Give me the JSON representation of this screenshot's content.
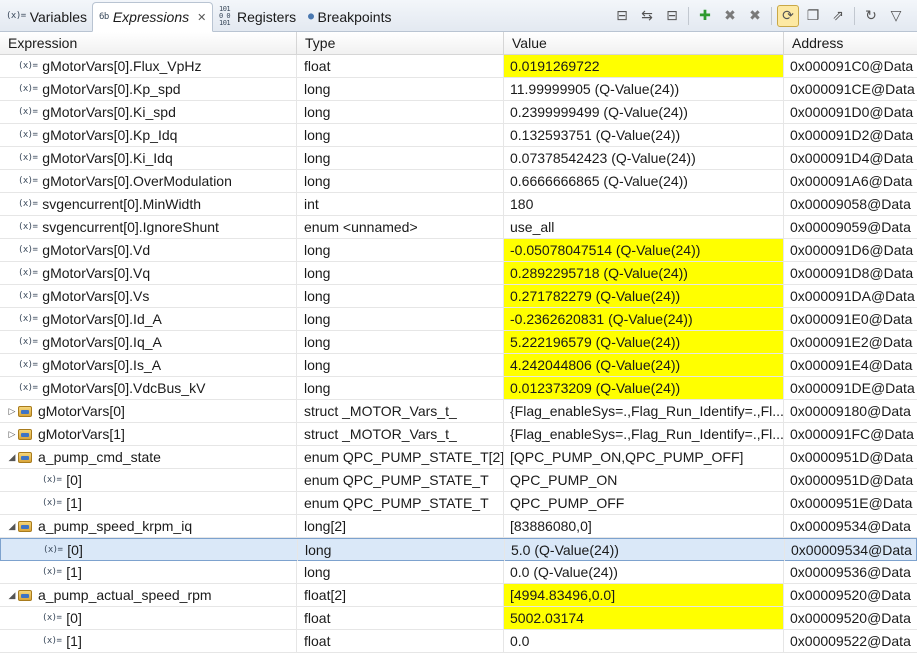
{
  "tabs": [
    {
      "label": "Variables",
      "icon": "(x)="
    },
    {
      "label": "Expressions",
      "icon": "6b",
      "close": "✕"
    },
    {
      "label": "Registers",
      "icon": "1010 0101"
    },
    {
      "label": "Breakpoints",
      "icon": "●"
    }
  ],
  "toolbar": [
    {
      "name": "collapse-all-icon",
      "glyph": "⊟"
    },
    {
      "name": "show-type-icon",
      "glyph": "⇆"
    },
    {
      "name": "minimize-icon",
      "glyph": "⊟"
    },
    {
      "name": "add-expression-icon",
      "glyph": "✚"
    },
    {
      "name": "remove-icon",
      "glyph": "✖"
    },
    {
      "name": "remove-all-icon",
      "glyph": "✖"
    },
    {
      "name": "continuous-refresh-icon",
      "glyph": "⟳"
    },
    {
      "name": "new-view-icon",
      "glyph": "❐"
    },
    {
      "name": "export-icon",
      "glyph": "⇗"
    },
    {
      "name": "refresh-icon",
      "glyph": "↻"
    },
    {
      "name": "view-menu-icon",
      "glyph": "▽"
    }
  ],
  "columns": {
    "expression": "Expression",
    "type": "Type",
    "value": "Value",
    "address": "Address"
  },
  "highlight_color": "#ffff00",
  "rows": [
    {
      "level": 0,
      "twisty": "",
      "icon": "var",
      "expr": "gMotorVars[0].Flux_VpHz",
      "type": "float",
      "value": "0.0191269722",
      "address": "0x000091C0@Data",
      "hl": true
    },
    {
      "level": 0,
      "twisty": "",
      "icon": "var",
      "expr": "gMotorVars[0].Kp_spd",
      "type": "long",
      "value": "11.99999905 (Q-Value(24))",
      "address": "0x000091CE@Data",
      "hl": false
    },
    {
      "level": 0,
      "twisty": "",
      "icon": "var",
      "expr": "gMotorVars[0].Ki_spd",
      "type": "long",
      "value": "0.2399999499 (Q-Value(24))",
      "address": "0x000091D0@Data",
      "hl": false
    },
    {
      "level": 0,
      "twisty": "",
      "icon": "var",
      "expr": "gMotorVars[0].Kp_Idq",
      "type": "long",
      "value": "0.132593751 (Q-Value(24))",
      "address": "0x000091D2@Data",
      "hl": false
    },
    {
      "level": 0,
      "twisty": "",
      "icon": "var",
      "expr": "gMotorVars[0].Ki_Idq",
      "type": "long",
      "value": "0.07378542423 (Q-Value(24))",
      "address": "0x000091D4@Data",
      "hl": false
    },
    {
      "level": 0,
      "twisty": "",
      "icon": "var",
      "expr": "gMotorVars[0].OverModulation",
      "type": "long",
      "value": "0.6666666865 (Q-Value(24))",
      "address": "0x000091A6@Data",
      "hl": false
    },
    {
      "level": 0,
      "twisty": "",
      "icon": "var",
      "expr": "svgencurrent[0].MinWidth",
      "type": "int",
      "value": "180",
      "address": "0x00009058@Data",
      "hl": false
    },
    {
      "level": 0,
      "twisty": "",
      "icon": "var",
      "expr": "svgencurrent[0].IgnoreShunt",
      "type": "enum <unnamed>",
      "value": "use_all",
      "address": "0x00009059@Data",
      "hl": false
    },
    {
      "level": 0,
      "twisty": "",
      "icon": "var",
      "expr": "gMotorVars[0].Vd",
      "type": "long",
      "value": "-0.05078047514 (Q-Value(24))",
      "address": "0x000091D6@Data",
      "hl": true
    },
    {
      "level": 0,
      "twisty": "",
      "icon": "var",
      "expr": "gMotorVars[0].Vq",
      "type": "long",
      "value": "0.2892295718 (Q-Value(24))",
      "address": "0x000091D8@Data",
      "hl": true
    },
    {
      "level": 0,
      "twisty": "",
      "icon": "var",
      "expr": "gMotorVars[0].Vs",
      "type": "long",
      "value": "0.271782279 (Q-Value(24))",
      "address": "0x000091DA@Data",
      "hl": true
    },
    {
      "level": 0,
      "twisty": "",
      "icon": "var",
      "expr": "gMotorVars[0].Id_A",
      "type": "long",
      "value": "-0.2362620831 (Q-Value(24))",
      "address": "0x000091E0@Data",
      "hl": true
    },
    {
      "level": 0,
      "twisty": "",
      "icon": "var",
      "expr": "gMotorVars[0].Iq_A",
      "type": "long",
      "value": "5.222196579 (Q-Value(24))",
      "address": "0x000091E2@Data",
      "hl": true
    },
    {
      "level": 0,
      "twisty": "",
      "icon": "var",
      "expr": "gMotorVars[0].Is_A",
      "type": "long",
      "value": "4.242044806 (Q-Value(24))",
      "address": "0x000091E4@Data",
      "hl": true
    },
    {
      "level": 0,
      "twisty": "",
      "icon": "var",
      "expr": "gMotorVars[0].VdcBus_kV",
      "type": "long",
      "value": "0.012373209 (Q-Value(24))",
      "address": "0x000091DE@Data",
      "hl": true
    },
    {
      "level": 0,
      "twisty": "▷",
      "icon": "struct",
      "expr": "gMotorVars[0]",
      "type": "struct _MOTOR_Vars_t_",
      "value": "{Flag_enableSys=.,Flag_Run_Identify=.,Fl...",
      "address": "0x00009180@Data",
      "hl": false
    },
    {
      "level": 0,
      "twisty": "▷",
      "icon": "struct",
      "expr": "gMotorVars[1]",
      "type": "struct _MOTOR_Vars_t_",
      "value": "{Flag_enableSys=.,Flag_Run_Identify=.,Fl...",
      "address": "0x000091FC@Data",
      "hl": false
    },
    {
      "level": 0,
      "twisty": "◢",
      "icon": "struct",
      "expr": "a_pump_cmd_state",
      "type": "enum QPC_PUMP_STATE_T[2]",
      "value": "[QPC_PUMP_ON,QPC_PUMP_OFF]",
      "address": "0x0000951D@Data",
      "hl": false
    },
    {
      "level": 1,
      "twisty": "",
      "icon": "var",
      "expr": "[0]",
      "type": "enum QPC_PUMP_STATE_T",
      "value": "QPC_PUMP_ON",
      "address": "0x0000951D@Data",
      "hl": false
    },
    {
      "level": 1,
      "twisty": "",
      "icon": "var",
      "expr": "[1]",
      "type": "enum QPC_PUMP_STATE_T",
      "value": "QPC_PUMP_OFF",
      "address": "0x0000951E@Data",
      "hl": false
    },
    {
      "level": 0,
      "twisty": "◢",
      "icon": "struct",
      "expr": "a_pump_speed_krpm_iq",
      "type": "long[2]",
      "value": "[83886080,0]",
      "address": "0x00009534@Data",
      "hl": false
    },
    {
      "level": 1,
      "twisty": "",
      "icon": "var",
      "expr": "[0]",
      "type": "long",
      "value": "5.0 (Q-Value(24))",
      "address": "0x00009534@Data",
      "hl": false,
      "selected": true
    },
    {
      "level": 1,
      "twisty": "",
      "icon": "var",
      "expr": "[1]",
      "type": "long",
      "value": "0.0 (Q-Value(24))",
      "address": "0x00009536@Data",
      "hl": false
    },
    {
      "level": 0,
      "twisty": "◢",
      "icon": "struct",
      "expr": "a_pump_actual_speed_rpm",
      "type": "float[2]",
      "value": "[4994.83496,0.0]",
      "address": "0x00009520@Data",
      "hl": true
    },
    {
      "level": 1,
      "twisty": "",
      "icon": "var",
      "expr": "[0]",
      "type": "float",
      "value": "5002.03174",
      "address": "0x00009520@Data",
      "hl": true
    },
    {
      "level": 1,
      "twisty": "",
      "icon": "var",
      "expr": "[1]",
      "type": "float",
      "value": "0.0",
      "address": "0x00009522@Data",
      "hl": false
    }
  ]
}
